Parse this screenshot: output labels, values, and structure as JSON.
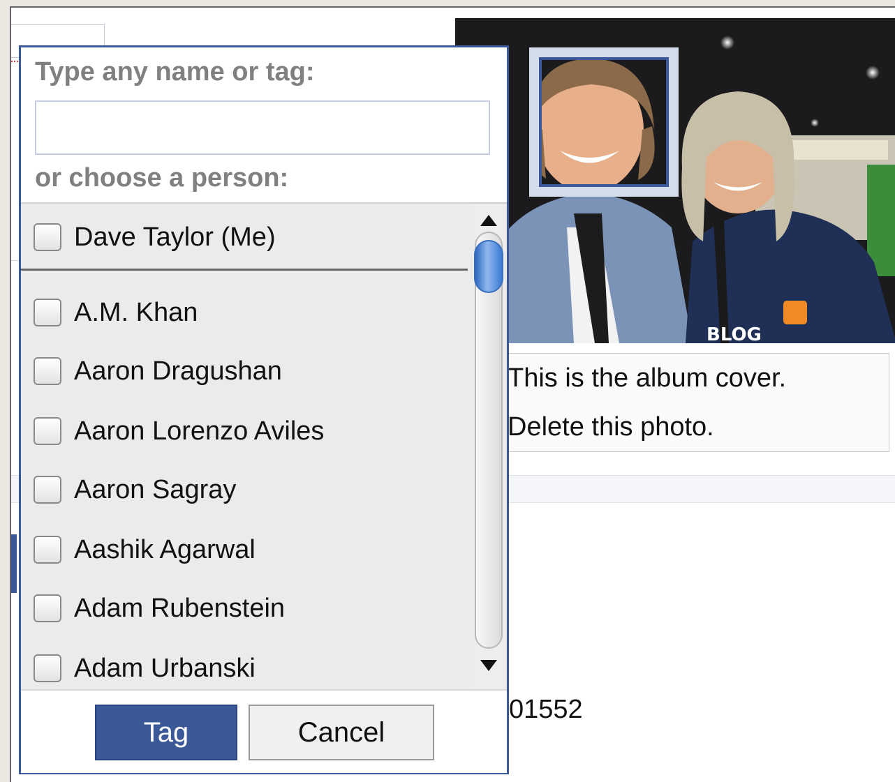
{
  "tag_dialog": {
    "prompt_label": "Type any name or tag:",
    "name_input_value": "",
    "choose_label": "or choose a person:",
    "self_entry": "Dave Taylor (Me)",
    "people": [
      "A.M. Khan",
      "Aaron Dragushan",
      "Aaron Lorenzo Aviles",
      "Aaron Sagray",
      "Aashik Agarwal",
      "Adam Rubenstein",
      "Adam Urbanski"
    ],
    "tag_button": "Tag",
    "cancel_button": "Cancel"
  },
  "photo_info": {
    "album_cover_text": "This is the album cover.",
    "delete_link": "Delete this photo."
  },
  "background": {
    "partial_number": "01552"
  },
  "colors": {
    "brand_blue": "#3b5998",
    "label_gray": "#808080",
    "list_bg": "#ebebeb"
  }
}
